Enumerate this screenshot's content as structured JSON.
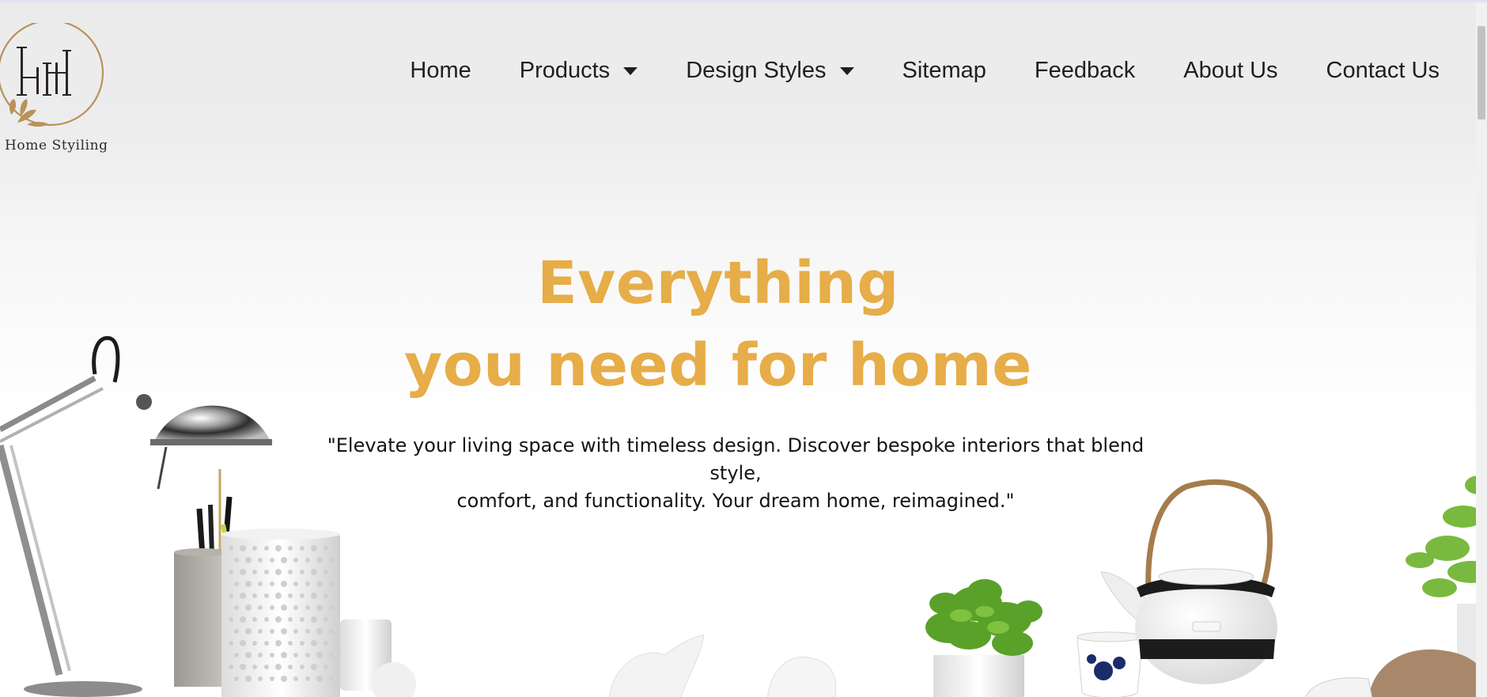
{
  "brand": {
    "monogram": "HH",
    "name": "Home Styiling",
    "accent_color": "#b9925a"
  },
  "nav": {
    "items": [
      {
        "label": "Home",
        "dropdown": false
      },
      {
        "label": "Products",
        "dropdown": true
      },
      {
        "label": "Design Styles",
        "dropdown": true
      },
      {
        "label": "Sitemap",
        "dropdown": false
      },
      {
        "label": "Feedback",
        "dropdown": false
      },
      {
        "label": "About Us",
        "dropdown": false
      },
      {
        "label": "Contact Us",
        "dropdown": false
      }
    ]
  },
  "hero": {
    "title_line1": "Everything",
    "title_line2": "you need for home",
    "quote_line1": "\"Elevate your living space with timeless design. Discover bespoke interiors that blend style,",
    "quote_line2": "comfort, and functionality. Your dream home, reimagined.\"",
    "title_color": "#e6ad48"
  },
  "icons": [
    "chevron-down-icon"
  ]
}
